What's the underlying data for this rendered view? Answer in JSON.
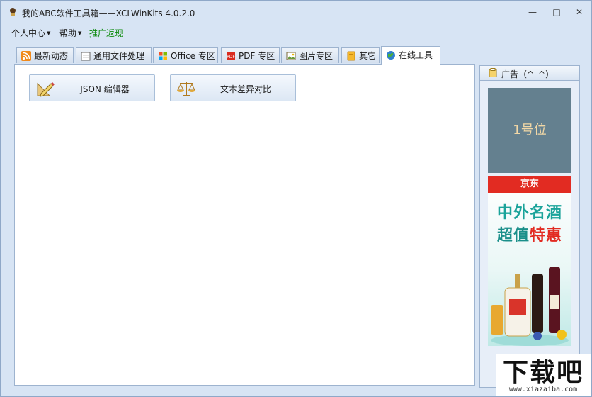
{
  "window": {
    "title": "我的ABC软件工具箱——XCLWinKits  4.0.2.0",
    "minimize": "—",
    "maximize": "□",
    "close": "✕"
  },
  "menu": {
    "items": [
      {
        "label": "个人中心",
        "arrow": "▼"
      },
      {
        "label": "帮助",
        "arrow": "▼"
      },
      {
        "label": "推广返现"
      }
    ],
    "promo_color": "#0b8a0b"
  },
  "tabs": [
    {
      "label": "最新动态",
      "icon": "rss-icon"
    },
    {
      "label": "通用文件处理",
      "icon": "file-tools-icon"
    },
    {
      "label": "Office 专区",
      "icon": "office-icon"
    },
    {
      "label": "PDF 专区",
      "icon": "pdf-icon"
    },
    {
      "label": "图片专区",
      "icon": "image-icon"
    },
    {
      "label": "其它",
      "icon": "folder-icon"
    },
    {
      "label": "在线工具",
      "icon": "globe-icon",
      "active": true
    }
  ],
  "tools": [
    {
      "label": "JSON 编辑器",
      "icon": "ruler-pencil-icon"
    },
    {
      "label": "文本差异对比",
      "icon": "scales-icon"
    }
  ],
  "ad": {
    "header": "广告（^_^）",
    "slot1_text": "1号位",
    "slot2": {
      "brand": "京东",
      "line1": "中外名酒",
      "line2_a": "超值",
      "line2_b": "特惠"
    }
  },
  "watermark": {
    "big": "下载吧",
    "small": "www.xiazaiba.com"
  },
  "colors": {
    "window_bg": "#d7e4f4",
    "accent_red": "#e22b22",
    "ad_teal": "#1aa39a",
    "ad_slot1_bg": "#64808f"
  }
}
